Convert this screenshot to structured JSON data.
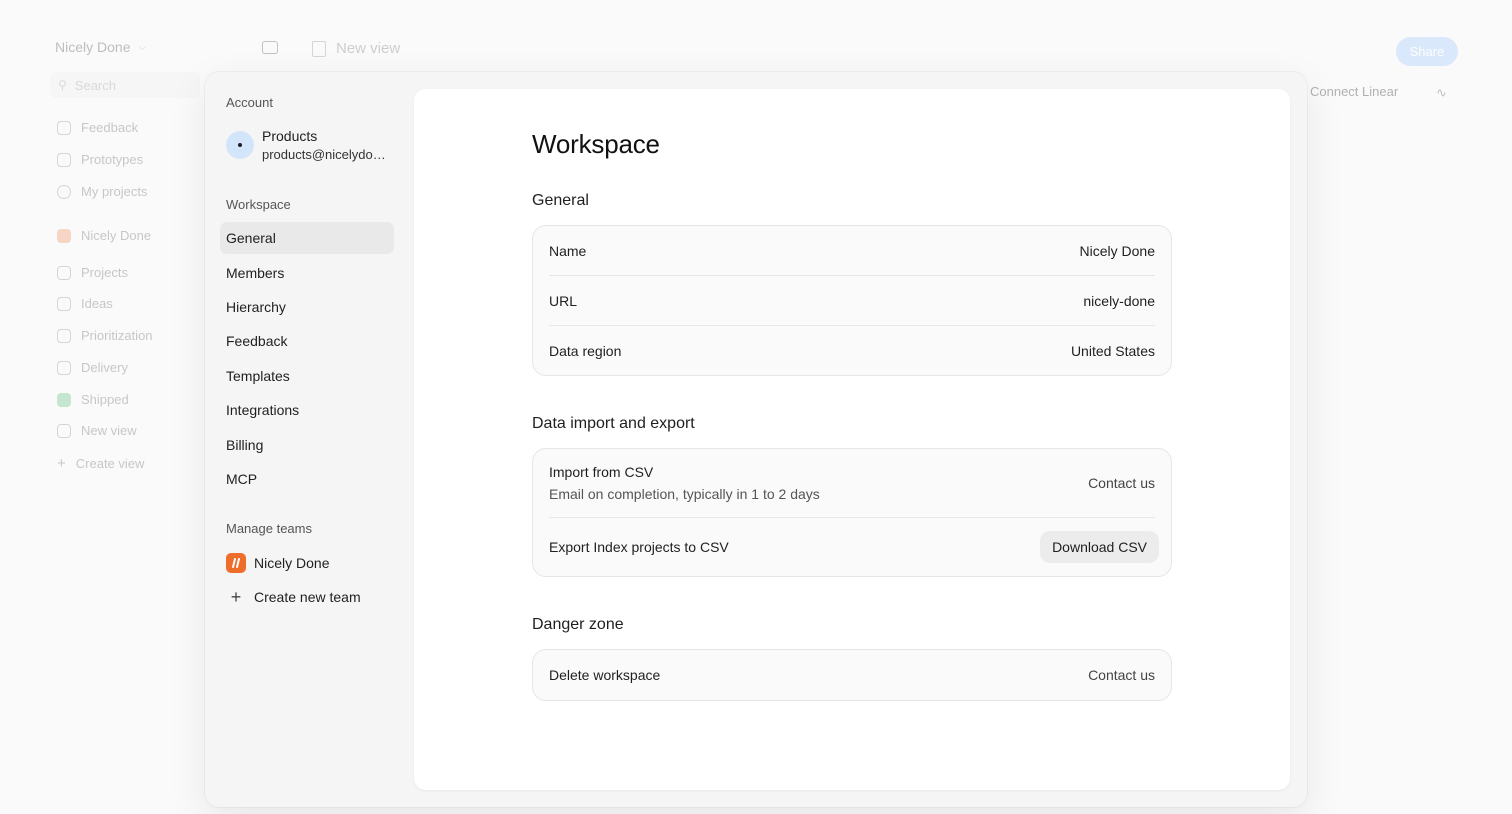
{
  "background": {
    "workspace_name": "Nicely Done",
    "search_placeholder": "Search",
    "nav": [
      "Feedback",
      "Prototypes",
      "My projects"
    ],
    "team_name": "Nicely Done",
    "team_nav": [
      "Projects",
      "Ideas",
      "Prioritization",
      "Delivery",
      "Shipped",
      "New view",
      "Create view"
    ],
    "view_title": "New view",
    "share_label": "Share",
    "connect_label": "Connect Linear"
  },
  "settings_nav": {
    "account_heading": "Account",
    "account_name": "Products",
    "account_email": "products@nicelydone.club",
    "workspace_heading": "Workspace",
    "workspace_items": [
      "General",
      "Members",
      "Hierarchy",
      "Feedback",
      "Templates",
      "Integrations",
      "Billing",
      "MCP"
    ],
    "active_item": "General",
    "teams_heading": "Manage teams",
    "team_name": "Nicely Done",
    "create_team_label": "Create new team"
  },
  "content": {
    "title": "Workspace",
    "general": {
      "heading": "General",
      "rows": [
        {
          "label": "Name",
          "value": "Nicely Done"
        },
        {
          "label": "URL",
          "value": "nicely-done"
        },
        {
          "label": "Data region",
          "value": "United States"
        }
      ]
    },
    "data": {
      "heading": "Data import and export",
      "import_label": "Import from CSV",
      "import_sub": "Email on completion, typically in 1 to 2 days",
      "import_action": "Contact us",
      "export_label": "Export Index projects to CSV",
      "export_action": "Download CSV"
    },
    "danger": {
      "heading": "Danger zone",
      "delete_label": "Delete workspace",
      "delete_action": "Contact us"
    }
  },
  "colors": {
    "accent_avatar": "#d3e5fa",
    "team_logo": "#ee6d2b",
    "active_nav": "#e9e9e9"
  }
}
